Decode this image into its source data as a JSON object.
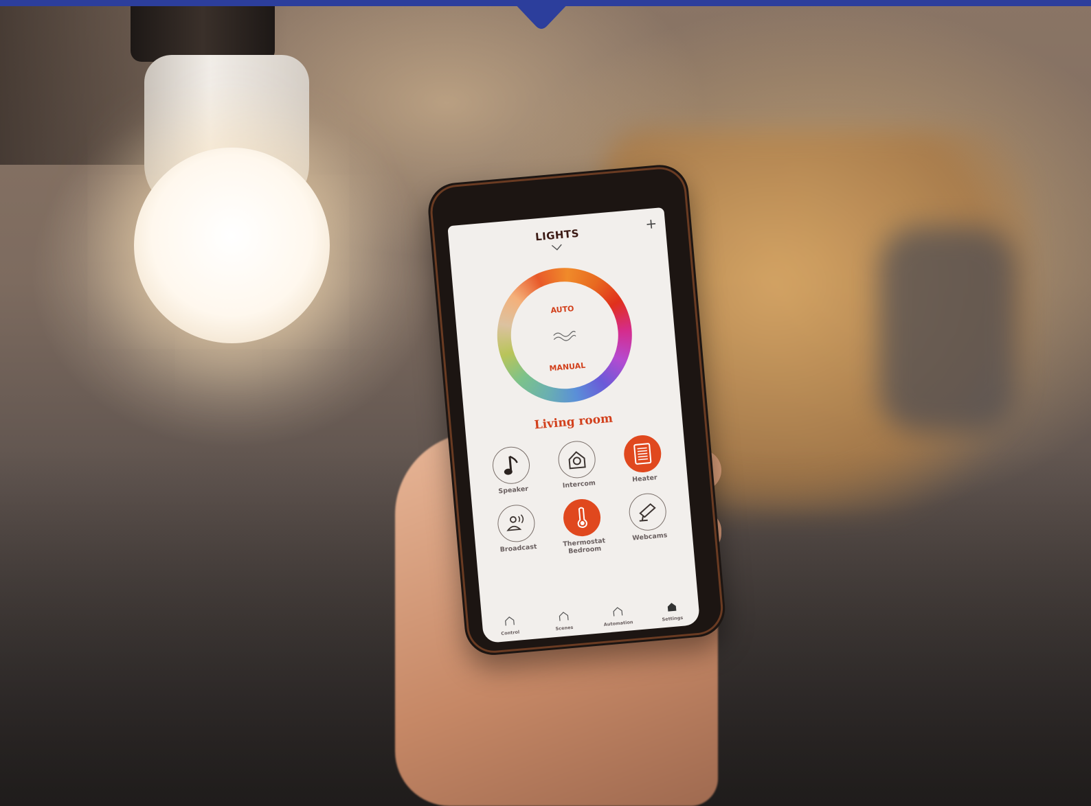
{
  "app": {
    "title": "LIGHTS",
    "modes": {
      "top": "AUTO",
      "bottom": "MANUAL"
    },
    "room": "Living room"
  },
  "tiles": [
    {
      "label": "Speaker",
      "icon": "music-note-icon",
      "active": false
    },
    {
      "label": "Intercom",
      "icon": "intercom-icon",
      "active": false
    },
    {
      "label": "Heater",
      "icon": "heater-icon",
      "active": true
    },
    {
      "label": "Broadcast",
      "icon": "broadcast-icon",
      "active": false
    },
    {
      "label": "Thermostat\nBedroom",
      "icon": "thermometer-icon",
      "active": true
    },
    {
      "label": "Webcams",
      "icon": "webcam-icon",
      "active": false
    }
  ],
  "tabs": [
    {
      "label": "Control",
      "icon": "home-outline-icon"
    },
    {
      "label": "Scenes",
      "icon": "home-outline-icon"
    },
    {
      "label": "Automation",
      "icon": "home-outline-icon"
    },
    {
      "label": "Settings",
      "icon": "home-filled-icon"
    }
  ],
  "colors": {
    "banner": "#2c3e9c",
    "accent": "#e0481e",
    "screen_bg": "#f2efec"
  }
}
